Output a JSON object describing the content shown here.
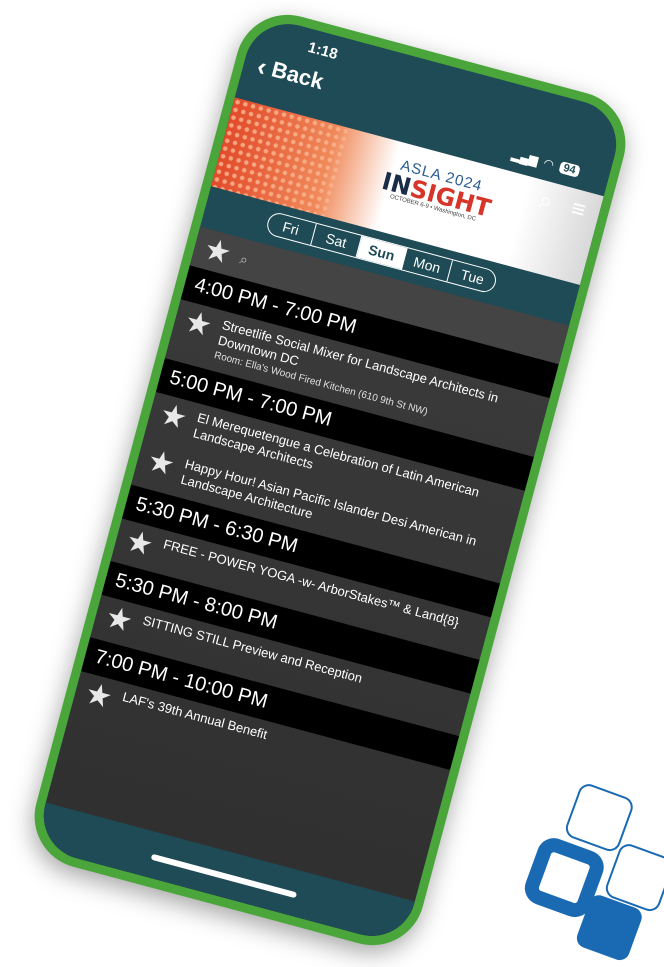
{
  "status": {
    "time": "1:18",
    "battery": "94"
  },
  "nav": {
    "back_label": "Back"
  },
  "banner": {
    "logo_line1": "ASLA 2024",
    "logo_in": "IN",
    "logo_rest": "SIGHT",
    "logo_line3": "OCTOBER 6-9 • Washington, DC"
  },
  "days": [
    "Fri",
    "Sat",
    "Sun",
    "Mon",
    "Tue"
  ],
  "selected_day": "Sun",
  "events": [
    {
      "time": "4:00 PM - 7:00 PM",
      "items": [
        {
          "title": "Streetlife Social Mixer for Landscape Architects in Downtown DC",
          "room": "Room: Ella's Wood Fired Kitchen (610 9th St NW)"
        }
      ]
    },
    {
      "time": "5:00 PM - 7:00 PM",
      "items": [
        {
          "title": "El Merequetengue a Celebration of Latin American Landscape Architects",
          "room": ""
        },
        {
          "title": "Happy Hour! Asian Pacific Islander Desi American in Landscape Architecture",
          "room": ""
        }
      ]
    },
    {
      "time": "5:30 PM - 6:30 PM",
      "items": [
        {
          "title": "FREE - POWER YOGA -w- ArborStakes™ & Land{8}",
          "room": ""
        }
      ]
    },
    {
      "time": "5:30 PM - 8:00 PM",
      "items": [
        {
          "title": "SITTING STILL Preview and Reception",
          "room": ""
        }
      ]
    },
    {
      "time": "7:00 PM - 10:00 PM",
      "items": [
        {
          "title": "LAF's 39th Annual Benefit",
          "room": ""
        }
      ]
    }
  ],
  "colors": {
    "accent_green": "#4aa63a",
    "header_teal": "#1f4b56",
    "brand_blue": "#1a6ab3"
  },
  "icons": {
    "home": "home-icon",
    "search": "search-icon",
    "menu": "hamburger-icon",
    "favorite": "star-icon"
  }
}
